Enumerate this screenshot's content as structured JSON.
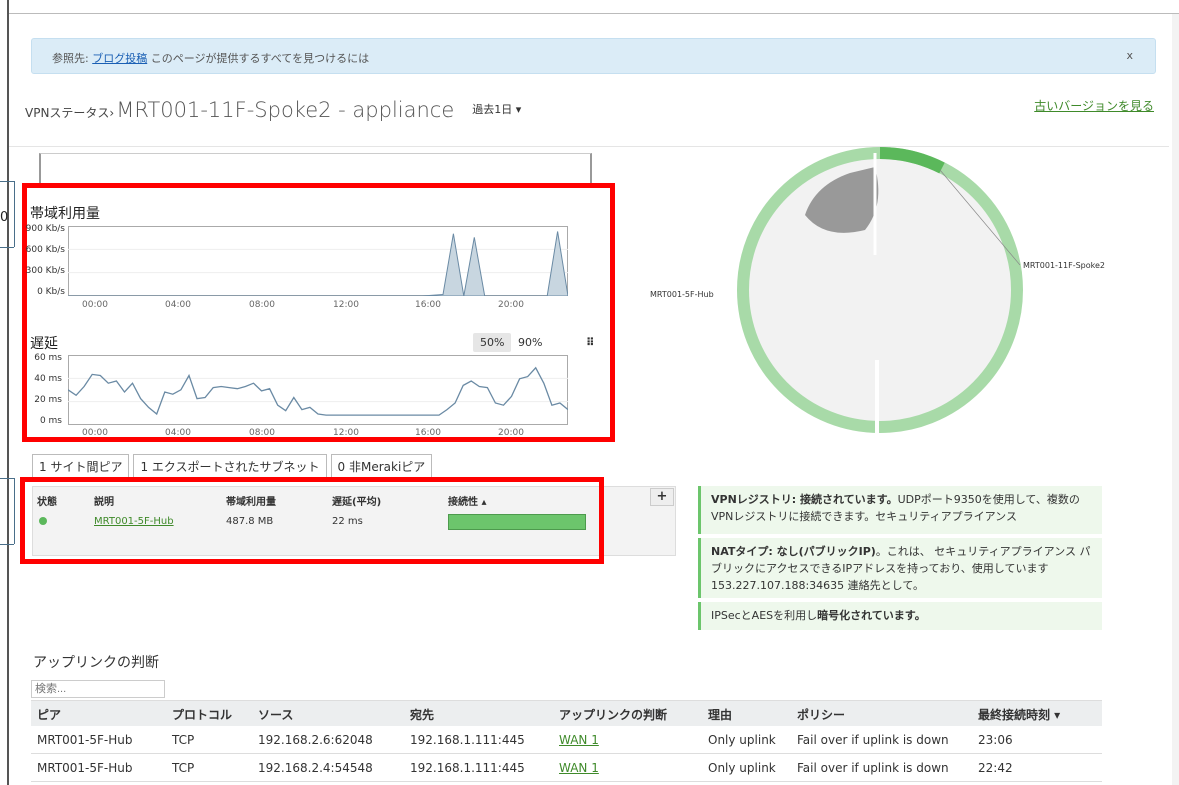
{
  "notice": {
    "prefix": "参照先:",
    "link": "ブログ投稿",
    "text": "このページが提供するすべてを見つけるには",
    "close": "x"
  },
  "header": {
    "crumb": "VPNステータス›",
    "title": "MRT001-11F-Spoke2 - appliance",
    "period": "過去1日 ▾",
    "old_version": "古いバージョンを見る"
  },
  "side_number": "0",
  "bandwidth": {
    "label": "帯域利用量",
    "yticks": [
      "900 Kb/s",
      "600 Kb/s",
      "300 Kb/s",
      "0 Kb/s"
    ],
    "xticks": [
      "00:00",
      "04:00",
      "08:00",
      "12:00",
      "16:00",
      "20:00"
    ]
  },
  "latency": {
    "label": "遅延",
    "yticks": [
      "60 ms",
      "40 ms",
      "20 ms",
      "0 ms"
    ],
    "xticks": [
      "00:00",
      "04:00",
      "08:00",
      "12:00",
      "16:00",
      "20:00"
    ],
    "pct_50": "50%",
    "pct_90": "90%",
    "grid_icon": "⠿"
  },
  "chart_data": [
    {
      "type": "area",
      "ylabel": "帯域利用量",
      "ylim": [
        0,
        900
      ],
      "x": [
        "00:00",
        "01:00",
        "02:00",
        "03:00",
        "04:00",
        "05:00",
        "06:00",
        "07:00",
        "08:00",
        "09:00",
        "10:00",
        "11:00",
        "12:00",
        "13:00",
        "14:00",
        "15:00",
        "16:00",
        "17:00",
        "18:00",
        "18:30",
        "19:00",
        "19:30",
        "20:00",
        "21:00",
        "22:00",
        "23:00",
        "23:30"
      ],
      "values": [
        0,
        0,
        0,
        0,
        0,
        0,
        0,
        0,
        0,
        0,
        0,
        0,
        0,
        0,
        0,
        0,
        0,
        0,
        20,
        850,
        0,
        800,
        0,
        0,
        0,
        0,
        880
      ]
    },
    {
      "type": "line",
      "ylabel": "遅延",
      "ylim": [
        0,
        60
      ],
      "values": [
        32,
        27,
        35,
        46,
        45,
        38,
        40,
        30,
        38,
        24,
        16,
        10,
        30,
        28,
        32,
        45,
        24,
        25,
        34,
        35,
        34,
        33,
        35,
        38,
        31,
        33,
        18,
        13,
        25,
        14,
        16,
        10,
        9,
        9,
        9,
        9,
        9,
        9,
        9,
        9,
        9,
        9,
        9,
        9,
        9,
        9,
        9,
        14,
        20,
        36,
        40,
        35,
        34,
        20,
        18,
        26,
        42,
        44,
        52,
        38,
        18,
        20,
        14
      ]
    }
  ],
  "donut": {
    "spoke_label": "MRT001-11F-Spoke2",
    "hub_label": "MRT001-5F-Hub"
  },
  "tabs": [
    "1 サイト間ピア",
    "1 エクスポートされたサブネット",
    "0 非Merakiピア"
  ],
  "peer_table": {
    "headers": [
      "状態",
      "説明",
      "帯域利用量",
      "遅延(平均)",
      "接続性 ▴"
    ],
    "plus": "+",
    "row": {
      "name": "MRT001-5F-Hub",
      "bandwidth": "487.8 MB",
      "latency": "22 ms",
      "connectivity": 1.0
    }
  },
  "info": {
    "registry_bold": "VPNレジストリ: 接続されています。",
    "registry_text": "UDPポート9350を使用して、複数のVPNレジストリに接続できます。セキュリティアプライアンス",
    "nat_bold": "NATタイプ: なし(パブリックIP)",
    "nat_text": "。これは、 セキュリティアプライアンス パブリックにアクセスできるIPアドレスを持っており、使用しています 153.227.107.188:34635 連絡先として。",
    "ipsec_text": "IPSecとAESを利用し",
    "ipsec_bold": "暗号化されています。"
  },
  "uplink": {
    "title": "アップリンクの判断",
    "search_placeholder": "検索...",
    "headers": [
      "ピア",
      "プロトコル",
      "ソース",
      "宛先",
      "アップリンクの判断",
      "理由",
      "ポリシー",
      "最終接続時刻 ▾"
    ],
    "rows": [
      [
        "MRT001-5F-Hub",
        "TCP",
        "192.168.2.6:62048",
        "192.168.1.111:445",
        "WAN 1",
        "Only uplink",
        "Fail over if uplink is down",
        "23:06"
      ],
      [
        "MRT001-5F-Hub",
        "TCP",
        "192.168.2.4:54548",
        "192.168.1.111:445",
        "WAN 1",
        "Only uplink",
        "Fail over if uplink is down",
        "22:42"
      ]
    ]
  }
}
